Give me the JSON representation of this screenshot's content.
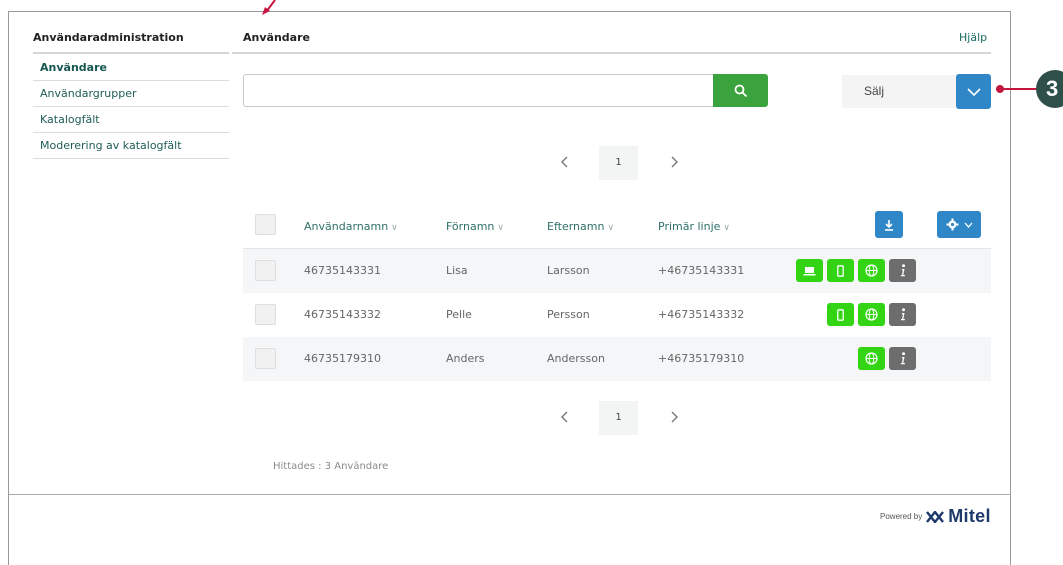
{
  "sidebar": {
    "title": "Användaradministration",
    "items": [
      {
        "label": "Användare",
        "active": true
      },
      {
        "label": "Användargrupper",
        "active": false
      },
      {
        "label": "Katalogfält",
        "active": false
      },
      {
        "label": "Moderering av katalogfält",
        "active": false
      }
    ]
  },
  "header": {
    "title": "Användare",
    "help": "Hjälp"
  },
  "search": {
    "value": "",
    "placeholder": ""
  },
  "select": {
    "value": "Sälj"
  },
  "pagination": {
    "page": "1"
  },
  "table": {
    "columns": [
      "Användarnamn",
      "Förnamn",
      "Efternamn",
      "Primär linje"
    ],
    "rows": [
      {
        "username": "46735143331",
        "first": "Lisa",
        "last": "Larsson",
        "line": "+46735143331",
        "icons": [
          "laptop-icon",
          "mobile-icon",
          "globe-icon",
          "info-icon"
        ]
      },
      {
        "username": "46735143332",
        "first": "Pelle",
        "last": "Persson",
        "line": "+46735143332",
        "icons": [
          "mobile-icon",
          "globe-icon",
          "info-icon"
        ]
      },
      {
        "username": "46735179310",
        "first": "Anders",
        "last": "Andersson",
        "line": "+46735179310",
        "icons": [
          "globe-icon",
          "info-icon"
        ]
      }
    ]
  },
  "found_text": "Hittades : 3 Användare",
  "footer": {
    "powered_by": "Powered by",
    "brand": "Mitel"
  },
  "callout": {
    "number": "3"
  },
  "colors": {
    "accent_green": "#3aa33d",
    "accent_blue": "#2f87c8",
    "status_green": "#33d414",
    "info_grey": "#6d6d6d",
    "callout_red": "#c4163f",
    "link_teal": "#1f5d56"
  }
}
